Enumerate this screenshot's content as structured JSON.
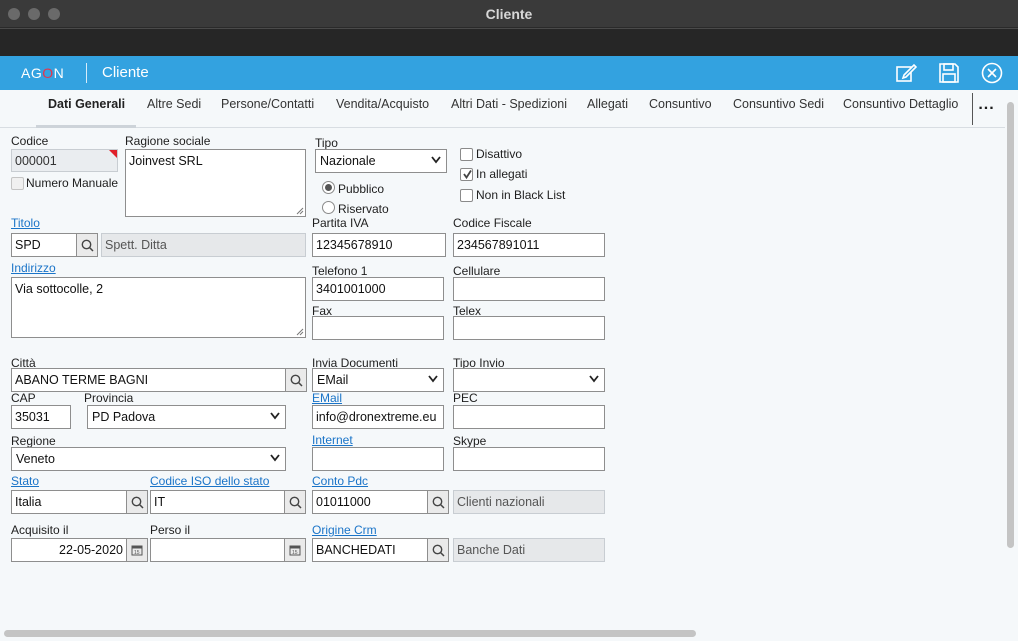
{
  "window": {
    "title": "Cliente"
  },
  "header": {
    "logo": "AGON",
    "title": "Cliente"
  },
  "tabs": [
    "Dati Generali",
    "Altre Sedi",
    "Persone/Contatti",
    "Vendita/Acquisto",
    "Altri Dati - Spedizioni",
    "Allegati",
    "Consuntivo",
    "Consuntivo Sedi",
    "Consuntivo Dettaglio"
  ],
  "tabs_more": "...",
  "form": {
    "codice": {
      "label": "Codice",
      "value": "000001"
    },
    "numero_manuale": {
      "label": "Numero Manuale",
      "checked": false
    },
    "ragione_sociale": {
      "label": "Ragione sociale",
      "value": "Joinvest SRL"
    },
    "tipo": {
      "label": "Tipo",
      "value": "Nazionale"
    },
    "pubblico": {
      "label": "Pubblico",
      "selected": true
    },
    "riservato": {
      "label": "Riservato",
      "selected": false
    },
    "disattivo": {
      "label": "Disattivo",
      "checked": false
    },
    "in_allegati": {
      "label": "In allegati",
      "checked": true
    },
    "non_black_list": {
      "label": "Non in Black List",
      "checked": false
    },
    "titolo": {
      "label": "Titolo",
      "code": "SPD",
      "description": "Spett. Ditta"
    },
    "partita_iva": {
      "label": "Partita IVA",
      "value": "12345678910"
    },
    "codice_fiscale": {
      "label": "Codice Fiscale",
      "value": "234567891011"
    },
    "indirizzo": {
      "label": "Indirizzo",
      "value": "Via sottocolle, 2"
    },
    "telefono1": {
      "label": "Telefono 1",
      "value": "3401001000"
    },
    "cellulare": {
      "label": "Cellulare",
      "value": ""
    },
    "fax": {
      "label": "Fax",
      "value": ""
    },
    "telex": {
      "label": "Telex",
      "value": ""
    },
    "citta": {
      "label": "Città",
      "value": "ABANO TERME BAGNI"
    },
    "invia_documenti": {
      "label": "Invia Documenti",
      "value": "EMail"
    },
    "tipo_invio": {
      "label": "Tipo Invio",
      "value": ""
    },
    "cap": {
      "label": "CAP",
      "value": "35031"
    },
    "provincia": {
      "label": "Provincia",
      "value": "PD Padova"
    },
    "email": {
      "label": "EMail",
      "value": "info@dronextreme.eu"
    },
    "pec": {
      "label": "PEC",
      "value": ""
    },
    "regione": {
      "label": "Regione",
      "value": "Veneto"
    },
    "internet": {
      "label": "Internet",
      "value": ""
    },
    "skype": {
      "label": "Skype",
      "value": ""
    },
    "stato": {
      "label": "Stato",
      "value": "Italia"
    },
    "codice_iso": {
      "label": "Codice ISO dello stato",
      "value": "IT"
    },
    "conto_pdc": {
      "label": "Conto Pdc",
      "code": "01011000",
      "description": "Clienti nazionali"
    },
    "acquisito_il": {
      "label": "Acquisito il",
      "value": "22-05-2020"
    },
    "perso_il": {
      "label": "Perso il",
      "value": ""
    },
    "origine_crm": {
      "label": "Origine Crm",
      "code": "BANCHEDATI",
      "description": "Banche Dati"
    }
  },
  "colors": {
    "accent": "#33a2e0",
    "link": "#1a74c8",
    "flag": "#e0202a"
  }
}
